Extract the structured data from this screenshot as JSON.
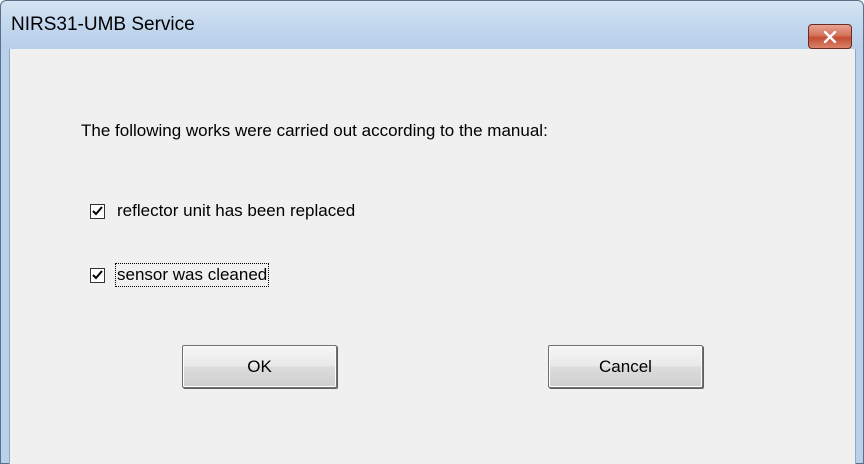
{
  "window": {
    "title": "NIRS31-UMB Service",
    "close_icon": "close-x-icon"
  },
  "dialog": {
    "message": "The following works were carried out according to the manual:",
    "checkboxes": [
      {
        "label": "reflector unit has been replaced",
        "checked": true
      },
      {
        "label": "sensor was cleaned",
        "checked": true,
        "focused": true
      }
    ],
    "ok_label": "OK",
    "cancel_label": "Cancel"
  },
  "colors": {
    "titlebar": "#c4d8ee",
    "client_background": "#f0f0f0",
    "close_button": "#c44c34"
  }
}
